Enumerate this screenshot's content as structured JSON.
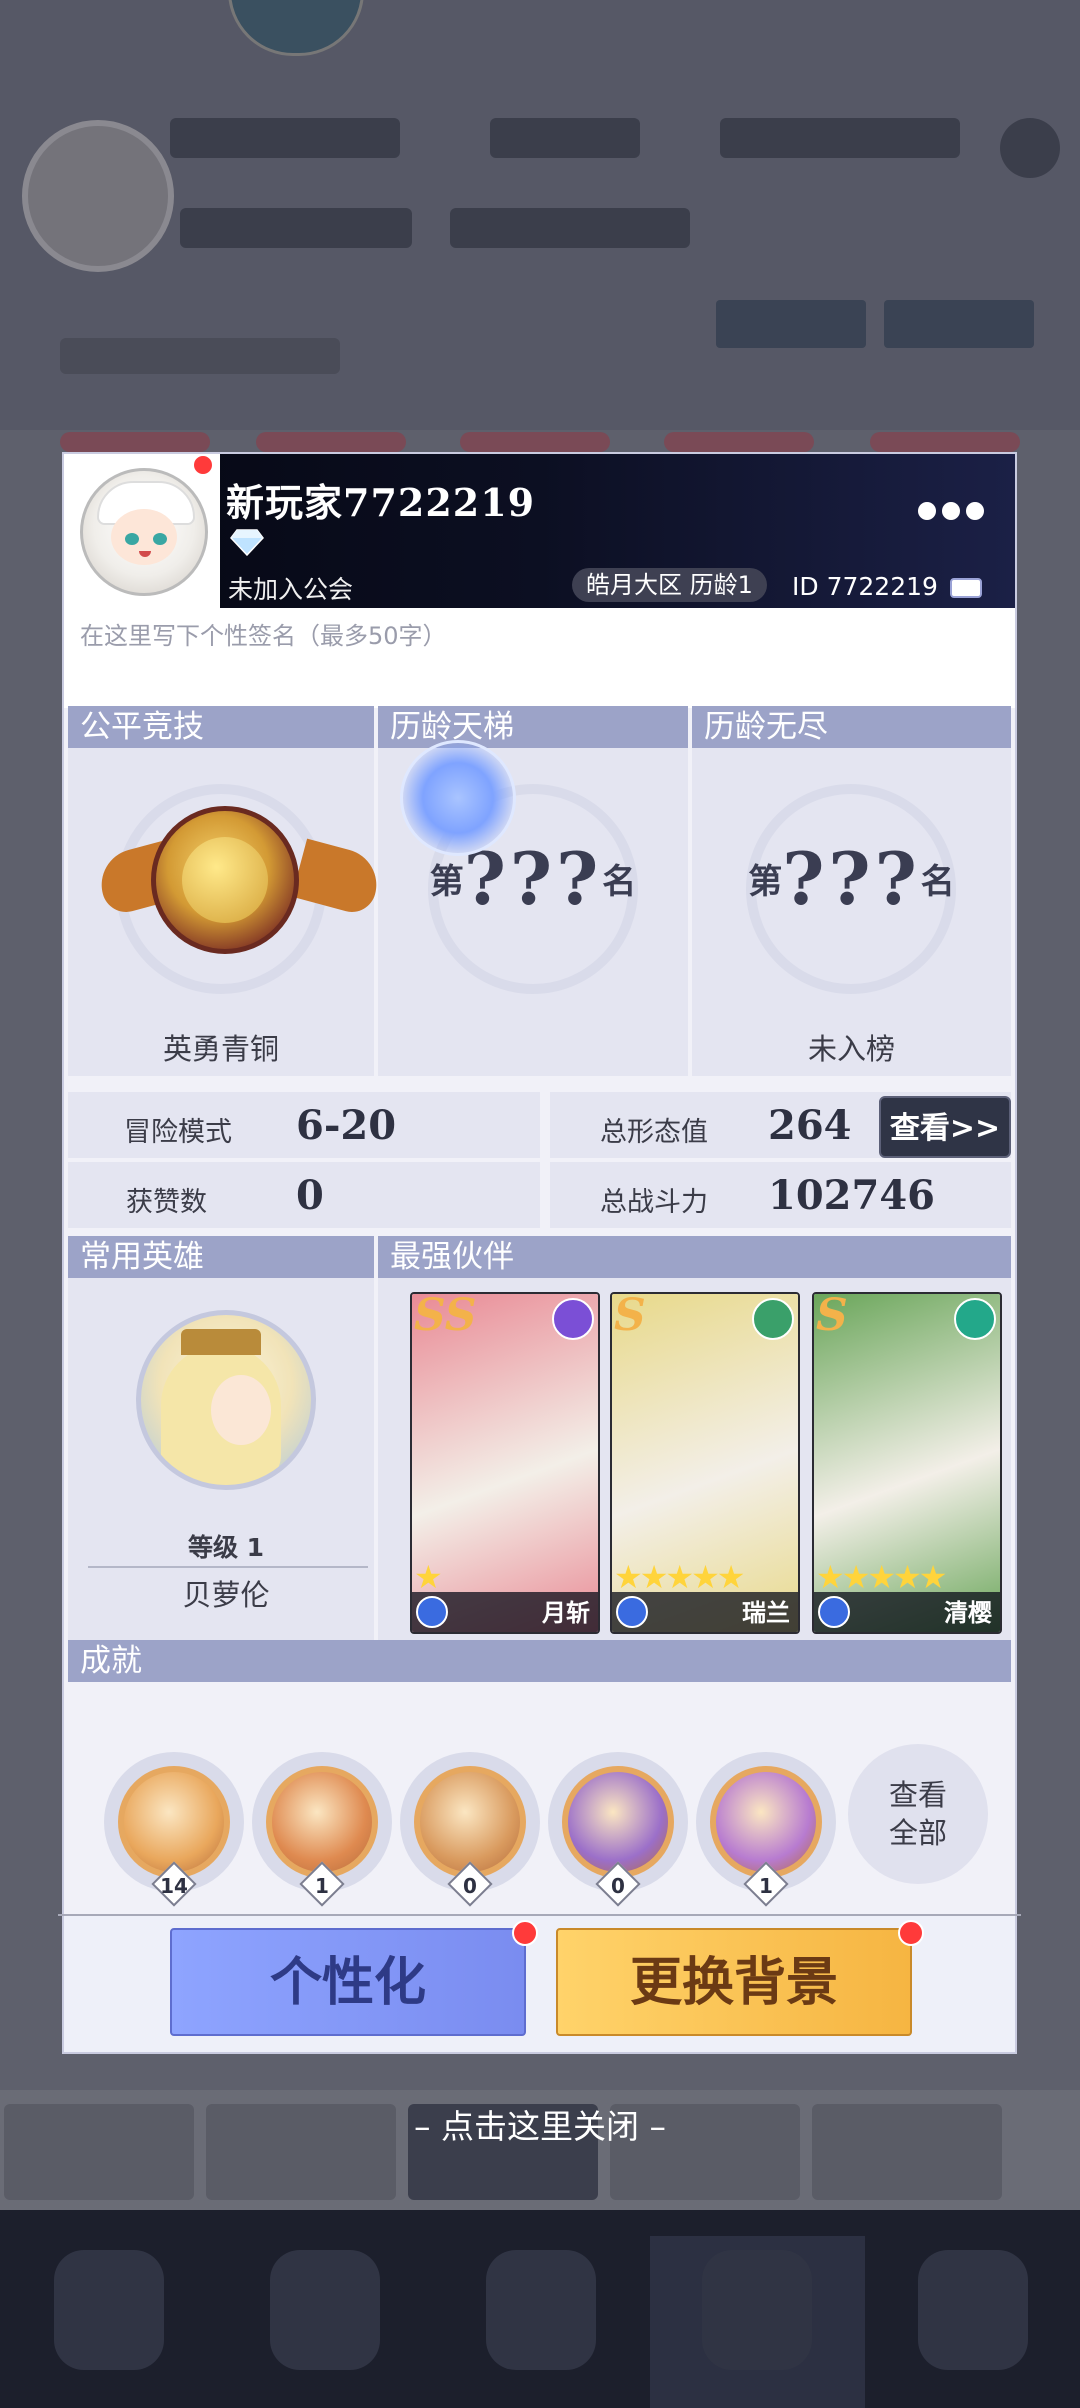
{
  "modal": {
    "player": {
      "name": "新玩家7722219",
      "guild": "未加入公会",
      "server": "皓月大区  历龄1",
      "id": "ID 7722219"
    },
    "signature_placeholder": "在这里写下个性签名（最多50字）",
    "ranks": {
      "fair": {
        "title": "公平竞技",
        "label": "英勇青铜"
      },
      "ladder": {
        "title": "历龄天梯",
        "prefix": "第",
        "number": "???",
        "suffix": "名"
      },
      "endless": {
        "title": "历龄无尽",
        "prefix": "第",
        "number": "???",
        "suffix": "名",
        "label": "未入榜"
      }
    },
    "stats": {
      "adventure_label": "冒险模式",
      "adventure_value": "6-20",
      "likes_label": "获赞数",
      "likes_value": "0",
      "form_label": "总形态值",
      "form_value": "264",
      "power_label": "总战斗力",
      "power_value": "102746",
      "view_button": "查看>>"
    },
    "hero": {
      "title": "常用英雄",
      "level": "等级 1",
      "name": "贝萝伦"
    },
    "partners": {
      "title": "最强伙伴",
      "cards": [
        {
          "rarity": "SS",
          "name": "月斩",
          "stars": "★",
          "element_color": "#7b4fd6",
          "art_color": "#e98a95"
        },
        {
          "rarity": "S",
          "name": "瑞兰",
          "stars": "★★★★★",
          "element_color": "#3aa06a",
          "art_color": "#e8d98a"
        },
        {
          "rarity": "S",
          "name": "清樱",
          "stars": "★★★★★",
          "element_color": "#23a88a",
          "art_color": "#6aa65a"
        }
      ]
    },
    "achievements": {
      "title": "成就",
      "items": [
        {
          "count": "14"
        },
        {
          "count": "1"
        },
        {
          "count": "0"
        },
        {
          "count": "0"
        },
        {
          "count": "1"
        }
      ],
      "view_all_line1": "查看",
      "view_all_line2": "全部"
    },
    "buttons": {
      "personalize": "个性化",
      "change_background": "更换背景"
    }
  },
  "close_hint": "– 点击这里关闭 –",
  "colors": {
    "section_header": "#9ca3c8",
    "header_bg": "#0c0f22",
    "notification_red": "#ff3a3a"
  }
}
